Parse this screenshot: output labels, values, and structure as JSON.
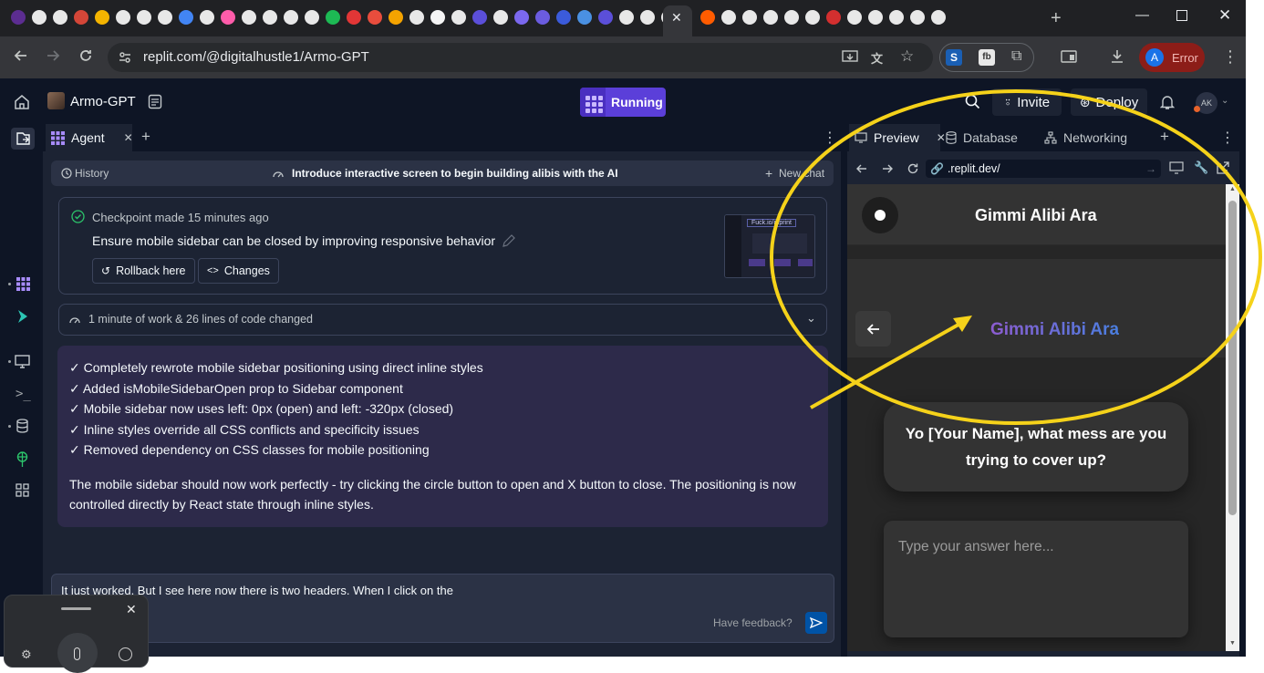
{
  "browser": {
    "url": "replit.com/@digitalhustle1/Armo-GPT",
    "profile_initial": "A",
    "profile_status": "Error",
    "new_tab_icon": "plus-icon",
    "tab_favicon_colors": [
      "#5c2d91",
      "#e8e8e8",
      "#e8e8e8",
      "#d44638",
      "#f4b400",
      "#e8e8e8",
      "#e8e8e8",
      "#e8e8e8",
      "#4285f4",
      "#e8e8e8",
      "#ff5caa",
      "#e8e8e8",
      "#e8e8e8",
      "#e8e8e8",
      "#e8e8e8",
      "#1db954",
      "#e23636",
      "#e84d3d",
      "#f4a300",
      "#e8e8e8",
      "#f5f5f5",
      "#e8e8e8",
      "#5b4fd9",
      "#e8e8e8",
      "#7b68ee",
      "#6b5ce0",
      "#3b5bdb",
      "#4a90e2",
      "#5b4fd9",
      "#e8e8e8",
      "#e8e8e8",
      "#e8e8e8",
      "#ff5c00",
      "#e8e8e8",
      "#e8e8e8",
      "#e8e8e8",
      "#e8e8e8",
      "#e8e8e8",
      "#d32f2f",
      "#e8e8e8",
      "#e8e8e8",
      "#e8e8e8",
      "#e8e8e8",
      "#e8e8e8"
    ]
  },
  "replit": {
    "project_name": "Armo-GPT",
    "run_label": "Running",
    "invite_label": "Invite",
    "deploy_label": "Deploy",
    "user_initials": "AK",
    "accent": "#5b3fd9"
  },
  "agent": {
    "tab_label": "Agent",
    "history_label": "History",
    "thread_title": "Introduce interactive screen to begin building alibis with the AI",
    "new_chat_label": "New chat",
    "checkpoint": {
      "subtitle": "Checkpoint made 15 minutes ago",
      "title": "Ensure mobile sidebar can be closed by improving responsive behavior",
      "rollback_label": "Rollback here",
      "changes_label": "Changes",
      "thumb_title": "Fuck.io/mprint"
    },
    "work_summary": "1 minute of work & 26 lines of code changed",
    "message": {
      "bullets": [
        "✓ Completely rewrote mobile sidebar positioning using direct inline styles",
        "✓ Added isMobileSidebarOpen prop to Sidebar component",
        "✓ Mobile sidebar now uses left: 0px (open) and left: -320px (closed)",
        "✓ Inline styles override all CSS conflicts and specificity issues",
        "✓ Removed dependency on CSS classes for mobile positioning"
      ],
      "paragraph": "The mobile sidebar should now work perfectly - try clicking the circle button to open and X button to close. The positioning is now controlled directly by React state through inline styles."
    },
    "input_text": "It just worked. But I see here now there is two headers. When I click on the",
    "feedback_label": "Have feedback?"
  },
  "preview": {
    "tabs": [
      {
        "label": "Preview"
      },
      {
        "label": "Database"
      },
      {
        "label": "Networking"
      }
    ],
    "url": ".replit.dev/",
    "site": {
      "header_title": "Gimmi Alibi Ara",
      "logo_text": "Gimmi Alibi Ara",
      "question": "Yo [Your Name], what mess are you trying to cover up?",
      "answer_placeholder": "Type your answer here..."
    }
  },
  "annotation": {
    "color": "#f5d21a"
  }
}
